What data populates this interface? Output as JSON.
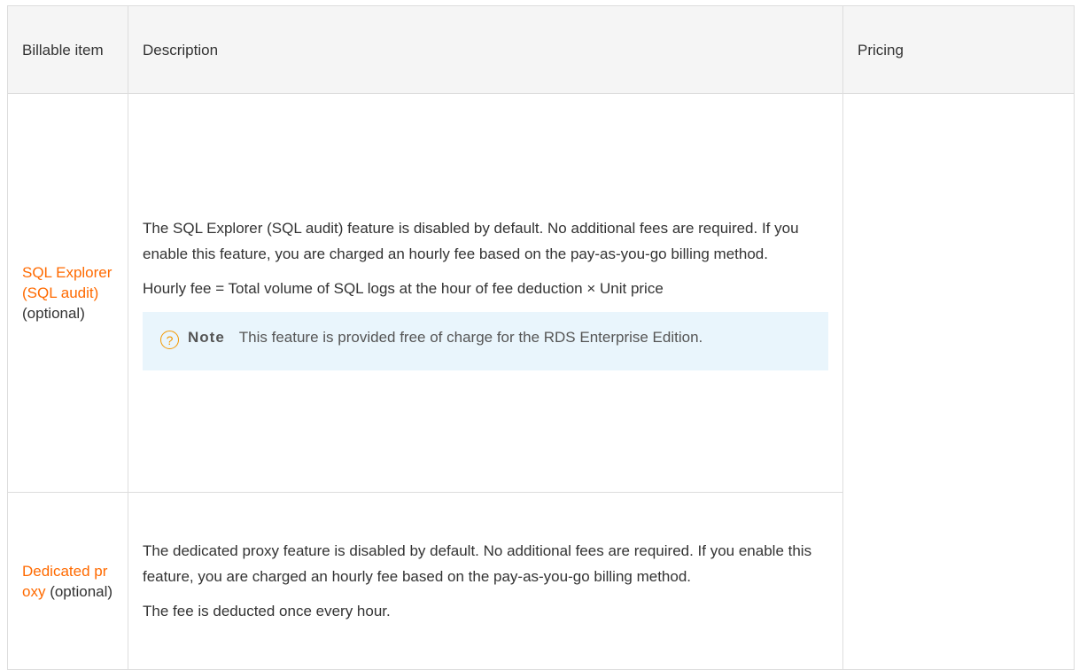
{
  "table": {
    "headers": {
      "item": "Billable item",
      "description": "Description",
      "pricing": "Pricing"
    },
    "rows": [
      {
        "item_link": "SQL Explorer (SQL audit)",
        "item_suffix": " (optional)",
        "paragraphs": [
          "The SQL Explorer (SQL audit) feature is disabled by default. No additional fees are required. If you enable this feature, you are charged an hourly fee based on the pay-as-you-go billing method.",
          "Hourly fee = Total volume of SQL logs at the hour of fee deduction × Unit price"
        ],
        "note": {
          "icon": "question-circle-icon",
          "label": "Note",
          "text": "This feature is provided free of charge for the RDS Enterprise Edition."
        }
      },
      {
        "item_link": "Dedicated proxy",
        "item_suffix": " (optional)",
        "paragraphs": [
          "The dedicated proxy feature is disabled by default. No additional fees are required. If you enable this feature, you are charged an hourly fee based on the pay-as-you-go billing method.",
          "The fee is deducted once every hour."
        ]
      }
    ]
  },
  "colors": {
    "link": "#ff6a00",
    "note_bg": "#e9f5fc",
    "note_icon": "#f39800",
    "header_bg": "#f5f5f5",
    "border": "#dddddd"
  }
}
